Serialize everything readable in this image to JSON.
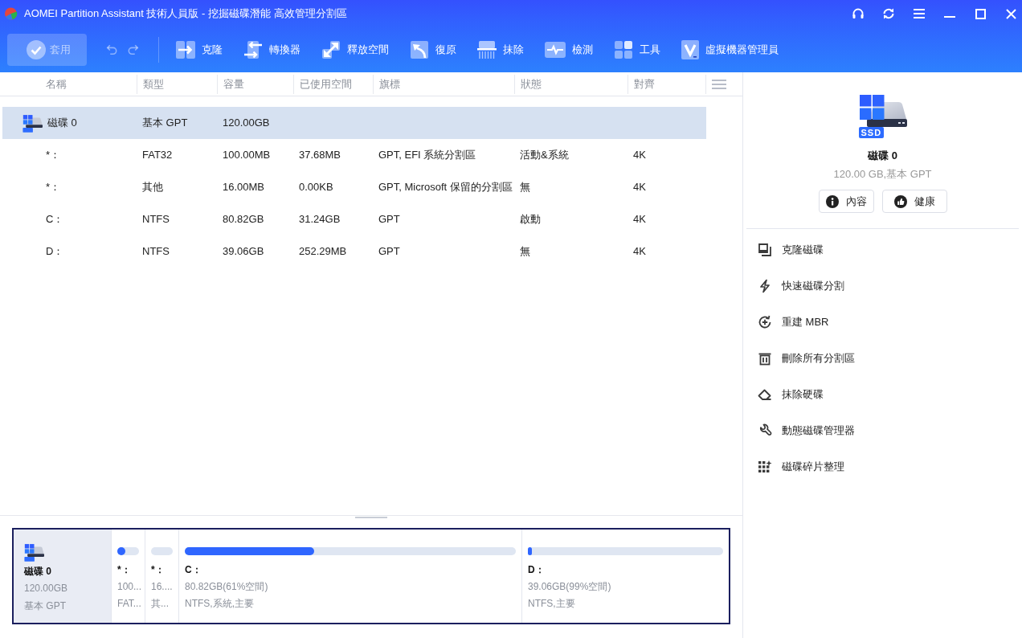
{
  "window": {
    "title": "AOMEI Partition Assistant 技術人員版 - 挖掘磁碟潛能 高效管理分割區"
  },
  "toolbar": {
    "apply": {
      "label": "套用",
      "disabled": true
    },
    "undo": {
      "disabled": true
    },
    "redo": {
      "disabled": true
    },
    "tools": [
      "克隆",
      "轉換器",
      "釋放空間",
      "復原",
      "抹除",
      "檢測",
      "工具",
      "虛擬機器管理員"
    ]
  },
  "table": {
    "columns": [
      "名稱",
      "類型",
      "容量",
      "已使用空間",
      "旗標",
      "狀態",
      "對齊"
    ],
    "rows": [
      {
        "kind": "disk",
        "selected": true,
        "cells": [
          "磁碟 0",
          "基本 GPT",
          "120.00GB"
        ]
      },
      {
        "kind": "partition",
        "selected": false,
        "cells": [
          "*：",
          "FAT32",
          "100.00MB",
          "37.68MB",
          "GPT, EFI 系統分割區",
          "活動&系統",
          "4K"
        ]
      },
      {
        "kind": "partition",
        "selected": false,
        "cells": [
          "*：",
          "其他",
          "16.00MB",
          "0.00KB",
          "GPT, Microsoft 保留的分割區",
          "無",
          "4K"
        ]
      },
      {
        "kind": "partition",
        "selected": false,
        "cells": [
          "C：",
          "NTFS",
          "80.82GB",
          "31.24GB",
          "GPT",
          "啟動",
          "4K"
        ]
      },
      {
        "kind": "partition",
        "selected": false,
        "cells": [
          "D：",
          "NTFS",
          "39.06GB",
          "252.29MB",
          "GPT",
          "無",
          "4K"
        ]
      }
    ]
  },
  "disk_map": {
    "selected": true,
    "disk": {
      "name": "磁碟 0",
      "size": "120.00GB",
      "type": "基本 GPT"
    },
    "partitions": [
      {
        "label": "*：",
        "level": 0.36,
        "size": "100...",
        "details": "FAT..."
      },
      {
        "label": "*：",
        "size": "16....",
        "details": "其..."
      },
      {
        "label": "C：",
        "level": 0.39,
        "size": "80.82GB(61%空間)",
        "details": "NTFS,系統,主要"
      },
      {
        "label": "D：",
        "level": 0.01,
        "size": "39.06GB(99%空間)",
        "details": "NTFS,主要"
      }
    ]
  },
  "disk_panel": {
    "name": "磁碟 0",
    "badge": "SSD",
    "summary": "120.00 GB,基本 GPT",
    "buttons": [
      "內容",
      "健康"
    ],
    "actions": [
      "克隆磁碟",
      "快速磁碟分割",
      "重建 MBR",
      "刪除所有分割區",
      "抹除硬碟",
      "動態磁碟管理器",
      "磁碟碎片整理"
    ]
  }
}
